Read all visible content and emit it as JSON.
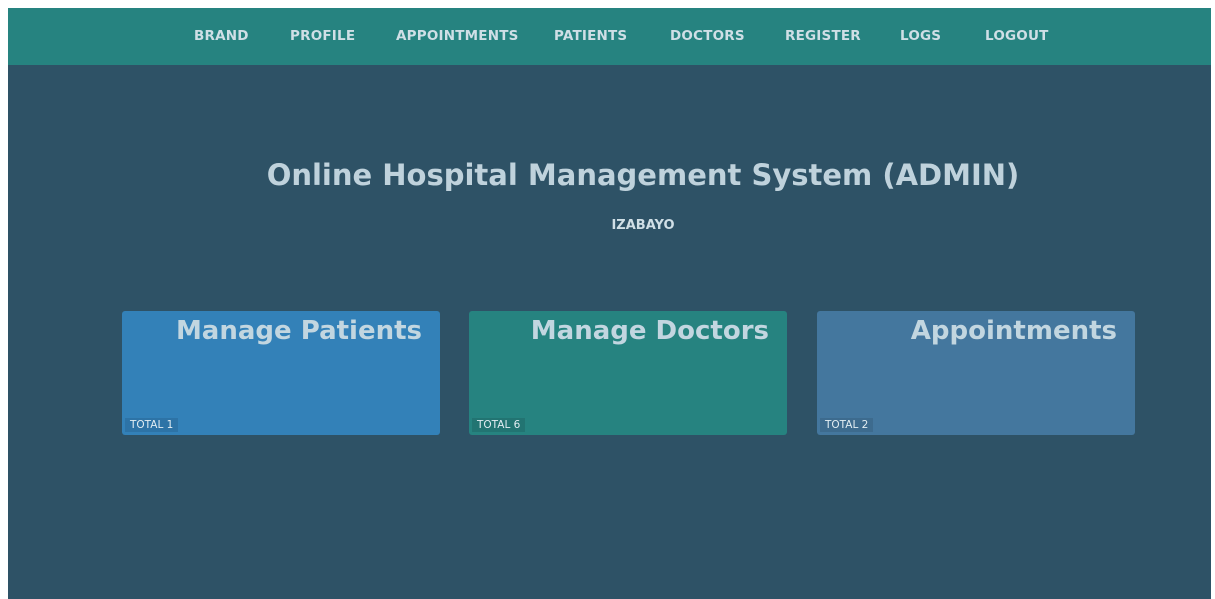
{
  "nav": {
    "items": [
      {
        "label": "BRAND"
      },
      {
        "label": "PROFILE"
      },
      {
        "label": "APPOINTMENTS"
      },
      {
        "label": "PATIENTS"
      },
      {
        "label": "DOCTORS"
      },
      {
        "label": "REGISTER"
      },
      {
        "label": "LOGS"
      },
      {
        "label": "LOGOUT"
      }
    ]
  },
  "header": {
    "title": "Online Hospital Management System (ADMIN)",
    "username": "IZABAYO"
  },
  "cards": [
    {
      "title": "Manage Patients",
      "total": "TOTAL 1",
      "color": "#3381b8"
    },
    {
      "title": "Manage Doctors",
      "total": "TOTAL 6",
      "color": "#268380"
    },
    {
      "title": "Appointments",
      "total": "TOTAL 2",
      "color": "#44779e"
    }
  ],
  "colors": {
    "navbar": "#268380",
    "background": "#2e5266"
  }
}
